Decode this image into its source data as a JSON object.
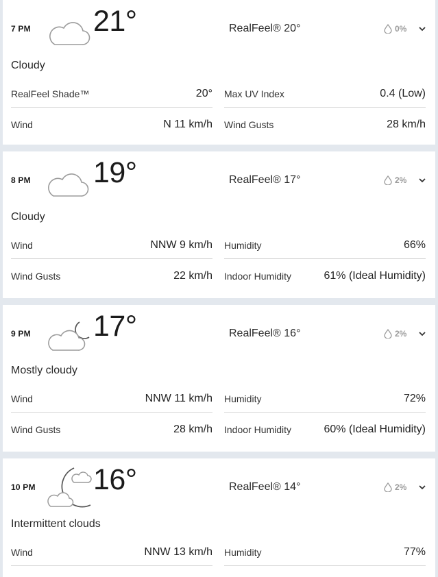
{
  "hours": [
    {
      "time": "7 PM",
      "icon": "cloud-icon",
      "temp": "21°",
      "realfeel": "RealFeel® 20°",
      "precip": "0%",
      "phrase": "Cloudy",
      "stats": [
        {
          "label": "RealFeel Shade™",
          "value": "20°"
        },
        {
          "label": "Max UV Index",
          "value": "0.4 (Low)"
        },
        {
          "label": "Wind",
          "value": "N 11 km/h"
        },
        {
          "label": "Wind Gusts",
          "value": "28 km/h"
        }
      ]
    },
    {
      "time": "8 PM",
      "icon": "cloud-icon",
      "temp": "19°",
      "realfeel": "RealFeel® 17°",
      "precip": "2%",
      "phrase": "Cloudy",
      "stats": [
        {
          "label": "Wind",
          "value": "NNW 9 km/h"
        },
        {
          "label": "Humidity",
          "value": "66%"
        },
        {
          "label": "Wind Gusts",
          "value": "22 km/h"
        },
        {
          "label": "Indoor Humidity",
          "value": "61% (Ideal Humidity)"
        }
      ]
    },
    {
      "time": "9 PM",
      "icon": "cloud-moon-icon",
      "temp": "17°",
      "realfeel": "RealFeel® 16°",
      "precip": "2%",
      "phrase": "Mostly cloudy",
      "stats": [
        {
          "label": "Wind",
          "value": "NNW 11 km/h"
        },
        {
          "label": "Humidity",
          "value": "72%"
        },
        {
          "label": "Wind Gusts",
          "value": "28 km/h"
        },
        {
          "label": "Indoor Humidity",
          "value": "60% (Ideal Humidity)"
        }
      ]
    },
    {
      "time": "10 PM",
      "icon": "moon-clouds-icon",
      "temp": "16°",
      "realfeel": "RealFeel® 14°",
      "precip": "2%",
      "phrase": "Intermittent clouds",
      "stats": [
        {
          "label": "Wind",
          "value": "NNW 13 km/h"
        },
        {
          "label": "Humidity",
          "value": "77%"
        },
        {
          "label": "",
          "value": ""
        },
        {
          "label": "",
          "value": ""
        }
      ]
    }
  ]
}
